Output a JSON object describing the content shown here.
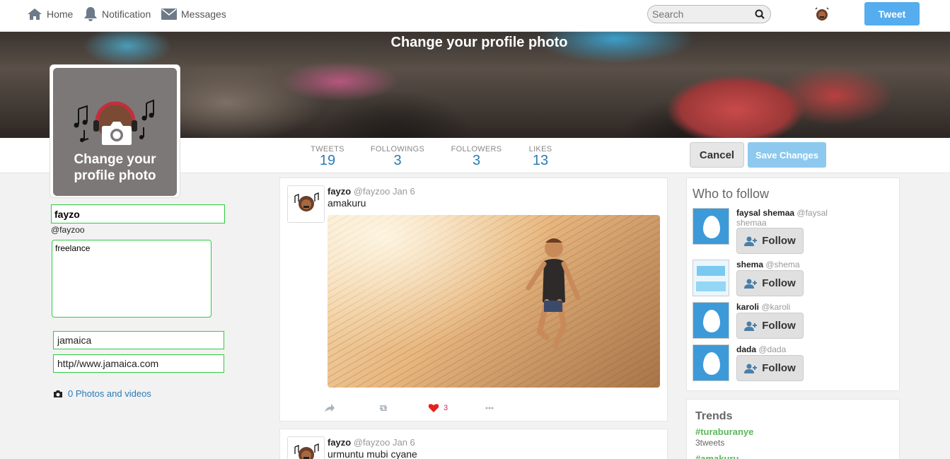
{
  "nav": {
    "home": "Home",
    "notification": "Notification",
    "messages": "Messages",
    "search_placeholder": "Search",
    "tweet_button": "Tweet"
  },
  "banner": {
    "title": "Change your profile photo"
  },
  "avatar": {
    "overlay_text": "Change your profile photo"
  },
  "stats": [
    {
      "label": "TWEETS",
      "value": "19"
    },
    {
      "label": "FOLLOWINGS",
      "value": "3"
    },
    {
      "label": "FOLLOWERS",
      "value": "3"
    },
    {
      "label": "LIKES",
      "value": "13"
    }
  ],
  "actions": {
    "cancel": "Cancel",
    "save": "Save Changes"
  },
  "profile": {
    "name": "fayzo",
    "handle": "@fayzoo",
    "bio": "freelance",
    "location": "jamaica",
    "website": "http//www.jamaica.com",
    "photos_link": "0 Photos and videos"
  },
  "tweets": [
    {
      "name": "fayzo",
      "meta": "@fayzoo Jan 6",
      "text": "amakuru",
      "likes": "3"
    },
    {
      "name": "fayzo",
      "meta": "@fayzoo Jan 6",
      "text": "urmuntu mubi cyane"
    }
  ],
  "who_to_follow": {
    "title": "Who to follow",
    "follow_label": "Follow",
    "users": [
      {
        "name": "faysal shemaa",
        "handle": "@faysal shemaa"
      },
      {
        "name": "shema",
        "handle": "@shema"
      },
      {
        "name": "karoli",
        "handle": "@karoli"
      },
      {
        "name": "dada",
        "handle": "@dada"
      }
    ]
  },
  "trends": {
    "title": "Trends",
    "items": [
      {
        "tag": "#turaburanye",
        "count": "3tweets"
      },
      {
        "tag": "#amakuru",
        "count": ""
      }
    ]
  },
  "colors": {
    "accent": "#55acee",
    "link": "#2a7bb5",
    "field_border": "#2ecc40",
    "like": "#e0245e",
    "trend": "#5cb85c"
  }
}
